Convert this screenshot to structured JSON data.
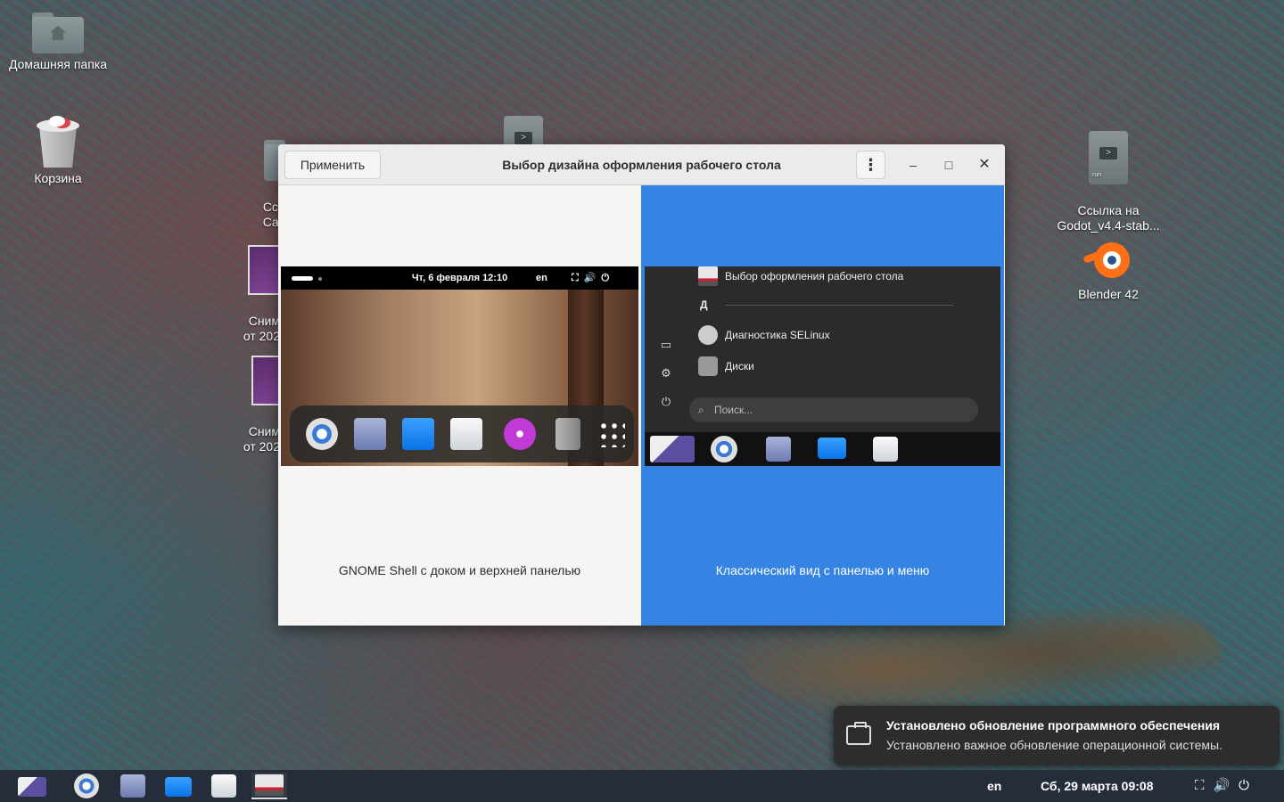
{
  "desktop": {
    "icons": [
      {
        "label": "Домашняя папка"
      },
      {
        "label": "Корзина"
      },
      {
        "label": "Ссы\nCarr"
      },
      {
        "label": "Сним\nот 202"
      },
      {
        "label": "Сним\nот 202"
      },
      {
        "label": "Ссылка на\nGodot_v4.4-stab..."
      },
      {
        "label": "Blender 42"
      }
    ],
    "run_ext": "run"
  },
  "window": {
    "title": "Выбор дизайна оформления рабочего стола",
    "apply_label": "Применить",
    "menu_glyph": "⋮",
    "minimize_glyph": "–",
    "maximize_glyph": "□",
    "close_glyph": "✕",
    "options": [
      {
        "label": "GNOME Shell с доком и верхней панелью",
        "selected": false
      },
      {
        "label": "Классический вид с панелью и меню",
        "selected": true
      }
    ],
    "accent": "#3584e4",
    "gnome_preview": {
      "clock": "Чт, 6 февраля  12:10",
      "lang": "en",
      "tray": "⛶🔊⏻"
    },
    "classic_preview": {
      "items": [
        {
          "label": "Выбор оформления рабочего стола"
        },
        {
          "label": "Диагностика SELinux"
        },
        {
          "label": "Диски"
        }
      ],
      "letter": "Д",
      "search_placeholder": "Поиск...",
      "side_icons": [
        "▭",
        "⚙",
        "⏻"
      ]
    }
  },
  "notification": {
    "title": "Установлено обновление программного обеспечения",
    "body": "Установлено важное обновление операционной системы."
  },
  "taskbar": {
    "lang": "en",
    "datetime": "Сб, 29 марта  09:08",
    "tray": "⛶🔊⏻"
  }
}
